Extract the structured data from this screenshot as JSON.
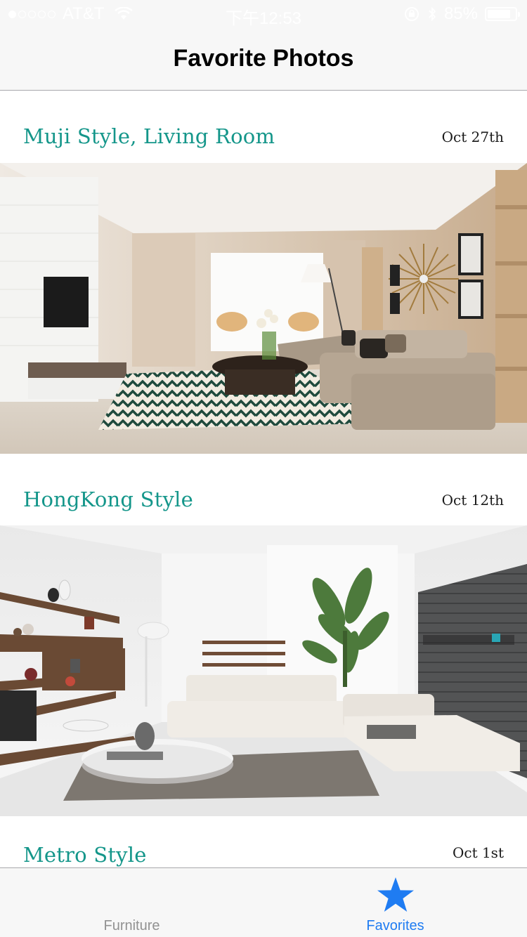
{
  "status_bar": {
    "carrier": "AT&T",
    "time": "下午12:53",
    "battery": "85%",
    "battery_level": 0.85
  },
  "nav": {
    "title": "Favorite Photos"
  },
  "photos": [
    {
      "title": "Muji Style, Living Room",
      "date": "Oct 27th"
    },
    {
      "title": "HongKong Style",
      "date": "Oct 12th"
    },
    {
      "title": "Metro Style",
      "date": "Oct 1st"
    }
  ],
  "tab_bar": {
    "furniture_label": "Furniture",
    "favorites_label": "Favorites"
  },
  "colors": {
    "accent": "#14968a",
    "tab_active": "#1f7cf2",
    "tab_inactive": "#929292"
  }
}
